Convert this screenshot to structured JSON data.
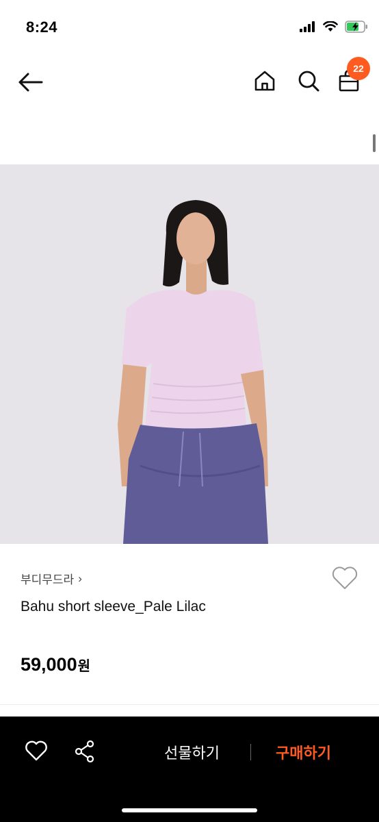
{
  "status_bar": {
    "time": "8:24"
  },
  "nav": {
    "cart_count": "22"
  },
  "product": {
    "brand": "부디무드라",
    "brand_chevron": "›",
    "name": "Bahu short sleeve_Pale Lilac",
    "price_amount": "59,000",
    "price_unit": "원"
  },
  "bottom_bar": {
    "gift_label": "선물하기",
    "buy_label": "구매하기"
  },
  "colors": {
    "accent": "#ff5a1f",
    "bottom_bar_bg": "#000000",
    "image_bg": "#e6e3e9",
    "shirt": "#ecd4ea",
    "pants": "#5f5c98"
  },
  "icons": [
    "back-arrow-icon",
    "home-icon",
    "search-icon",
    "shopping-bag-icon",
    "heart-icon",
    "share-icon",
    "signal-icon",
    "wifi-icon",
    "battery-icon"
  ]
}
